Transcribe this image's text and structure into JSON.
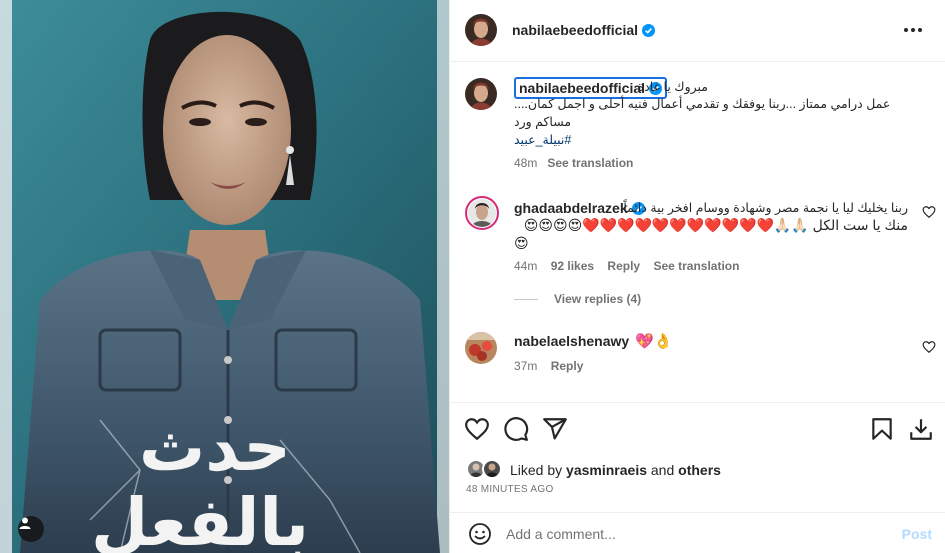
{
  "post": {
    "author": "nabilaebeedofficial",
    "poster_title_lines": [
      "حدث",
      "بالفعل"
    ]
  },
  "caption": {
    "author": "nabilaebeedofficial",
    "line1": "مبروك يا غادة",
    "line2": "عمل درامي ممتاز ...ربنا يوفقك و تقدمي أعمال فنيه أحلى و اجمل كمان....",
    "line3": "مساكم ورد",
    "hashtag": "#نبيلة_عبيد",
    "time": "48m",
    "see_translation": "See translation"
  },
  "comments": [
    {
      "author": "ghadaabdelrazek",
      "line1": "ربنا يخليك ليا يا نجمة مصر وشهادة ووسام افخر بية دائماً",
      "line2": "منك يا ست الكل 🙏🏻🙏🏻❤️❤️❤️❤️❤️❤️❤️❤️❤️❤️❤️😍😍😍😍",
      "line3": "😍",
      "time": "44m",
      "likes": "92 likes",
      "reply": "Reply",
      "see_translation": "See translation",
      "view_replies": "View replies (4)"
    },
    {
      "author": "nabelaelshenawy",
      "text": "💖👌",
      "time": "37m",
      "reply": "Reply"
    }
  ],
  "likes": {
    "liked_by_prefix": "Liked by ",
    "liked_by_user": "yasminraeis",
    "liked_by_and": " and ",
    "liked_by_others": "others",
    "time_ago": "48 MINUTES AGO"
  },
  "comment_box": {
    "placeholder": "Add a comment...",
    "post_label": "Post"
  },
  "colors": {
    "verified": "#0095f6",
    "link": "#00376b",
    "post_disabled": "#b3dbff",
    "meta_text": "#737373"
  },
  "icons": [
    "heart-icon",
    "comment-icon",
    "share-icon",
    "bookmark-icon",
    "download-icon",
    "emoji-icon",
    "more-icon",
    "verified-badge-icon",
    "tag-user-icon"
  ]
}
